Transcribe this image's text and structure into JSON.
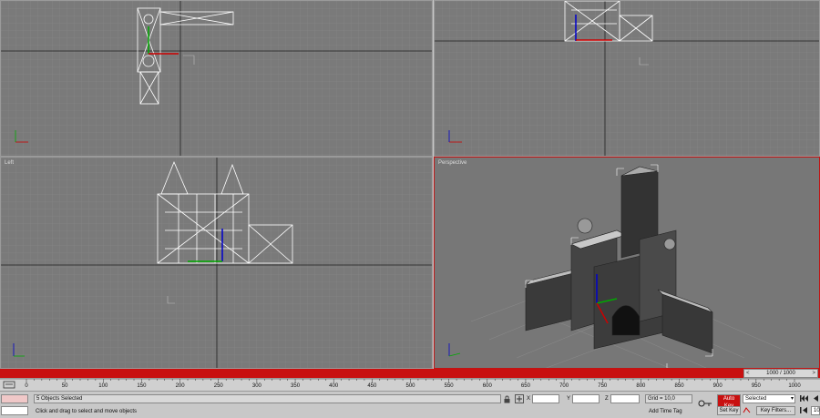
{
  "viewports": {
    "top": {
      "label": ""
    },
    "front": {
      "label": ""
    },
    "left": {
      "label": "Left"
    },
    "perspective": {
      "label": "Perspective"
    }
  },
  "timeline": {
    "frame_display": "1000 / 1000",
    "prev_arrow": "<",
    "next_arrow": ">",
    "ruler_ticks": [
      "0",
      "50",
      "100",
      "150",
      "200",
      "250",
      "300",
      "350",
      "400",
      "450",
      "500",
      "550",
      "600",
      "650",
      "700",
      "750",
      "800",
      "850",
      "900",
      "950",
      "1000"
    ]
  },
  "status": {
    "selection_text": "5 Objects Selected",
    "prompt_text": "Click and drag to select and move objects",
    "x_label": "X",
    "y_label": "Y",
    "z_label": "Z",
    "x_value": "",
    "y_value": "",
    "z_value": "",
    "grid_text": "Grid = 10,0",
    "add_time_tag": "Add Time Tag",
    "auto_key": "Auto Key",
    "set_key": "Set Key",
    "key_filter_select": "Selected",
    "key_filters": "Key Filters...",
    "frame_field": "10"
  },
  "colors": {
    "timebar": "#c81010",
    "viewport_bg": "#7a7a7a",
    "active_border": "#c01414"
  }
}
